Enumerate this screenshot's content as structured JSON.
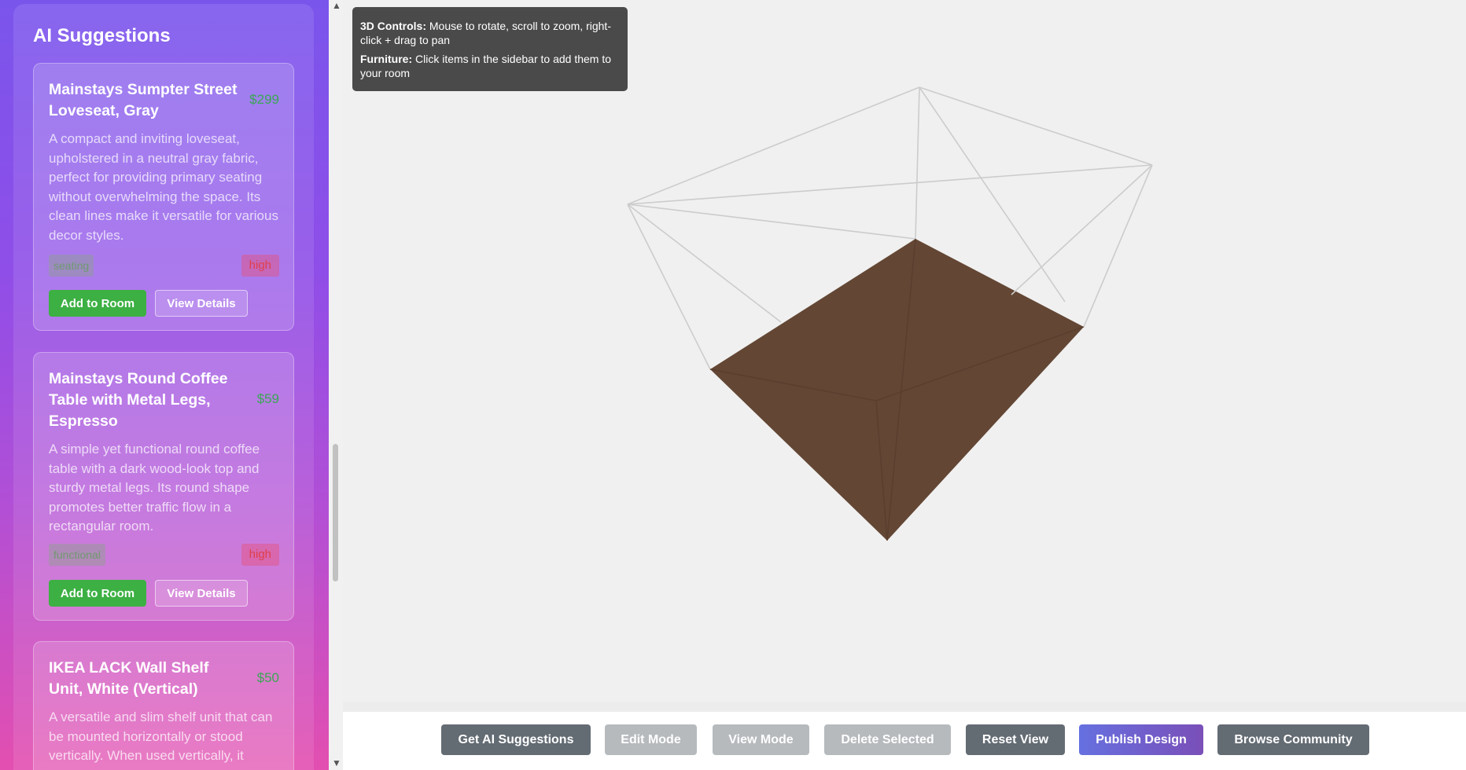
{
  "sidebar": {
    "title": "AI Suggestions",
    "cards": [
      {
        "title": "Mainstays Sumpter Street Loveseat, Gray",
        "price": "$299",
        "description": "A compact and inviting loveseat, upholstered in a neutral gray fabric, perfect for providing primary seating without overwhelming the space. Its clean lines make it versatile for various decor styles.",
        "category": "seating",
        "priority": "high",
        "add_label": "Add to Room",
        "details_label": "View Details"
      },
      {
        "title": "Mainstays Round Coffee Table with Metal Legs, Espresso",
        "price": "$59",
        "description": "A simple yet functional round coffee table with a dark wood-look top and sturdy metal legs. Its round shape promotes better traffic flow in a rectangular room.",
        "category": "functional",
        "priority": "high",
        "add_label": "Add to Room",
        "details_label": "View Details"
      },
      {
        "title": "IKEA LACK Wall Shelf Unit, White (Vertical)",
        "price": "$50",
        "description": "A versatile and slim shelf unit that can be mounted horizontally or stood vertically. When used vertically, it"
      }
    ]
  },
  "viewport": {
    "tooltip": {
      "controls_label": "3D Controls:",
      "controls_text": " Mouse to rotate, scroll to zoom, right-click + drag to pan",
      "furniture_label": "Furniture:",
      "furniture_text": " Click items in the sidebar to add them to your room"
    },
    "floor_color": "#634634",
    "wire_color": "#cccccc"
  },
  "toolbar": {
    "get_ai": "Get AI Suggestions",
    "edit_mode": "Edit Mode",
    "view_mode": "View Mode",
    "delete_selected": "Delete Selected",
    "reset_view": "Reset View",
    "publish": "Publish Design",
    "browse": "Browse Community"
  },
  "scrollbar": {
    "up_icon": "▲",
    "down_icon": "▼"
  }
}
